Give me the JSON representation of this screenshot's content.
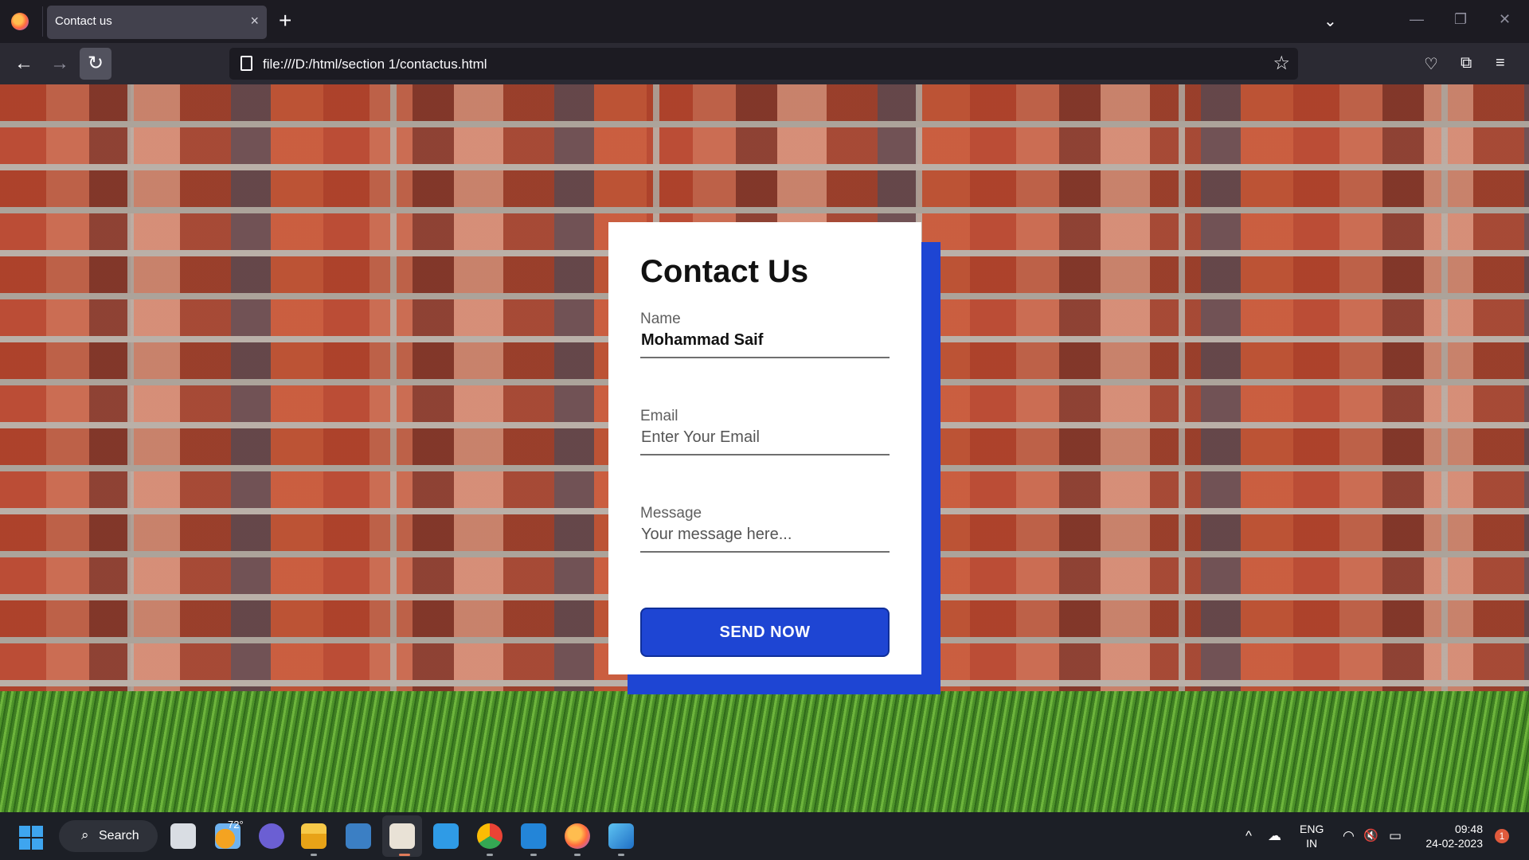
{
  "browser": {
    "tab_title": "Contact us",
    "tab_close": "×",
    "new_tab": "+",
    "tab_list": "⌄",
    "url": "file:///D:/html/section 1/contactus.html",
    "window_controls": {
      "minimize": "—",
      "maximize": "❐",
      "close": "✕"
    },
    "nav": {
      "back": "←",
      "forward": "→",
      "reload": "↻"
    },
    "bookmark_star": "☆",
    "toolbar_icons": {
      "pocket": "♡",
      "extensions": "⧉",
      "menu": "≡"
    }
  },
  "page": {
    "title": "Contact Us",
    "fields": {
      "name": {
        "label": "Name",
        "value": "Mohammad Saif"
      },
      "email": {
        "label": "Email",
        "placeholder": "Enter Your Email"
      },
      "message": {
        "label": "Message",
        "placeholder": "Your message here..."
      }
    },
    "submit_label": "SEND NOW",
    "colors": {
      "accent": "#1e45d3",
      "card": "#ffffff"
    }
  },
  "taskbar": {
    "search_label": "Search",
    "search_icon": "⌕",
    "weather_temp": "72°",
    "tray": {
      "chevron": "^",
      "cloud": "☁",
      "wifi": "◠",
      "volume": "🔇",
      "battery": "▭"
    },
    "language": {
      "line1": "ENG",
      "line2": "IN"
    },
    "clock": {
      "time": "09:48",
      "date": "24-02-2023"
    },
    "notification_count": "1"
  }
}
